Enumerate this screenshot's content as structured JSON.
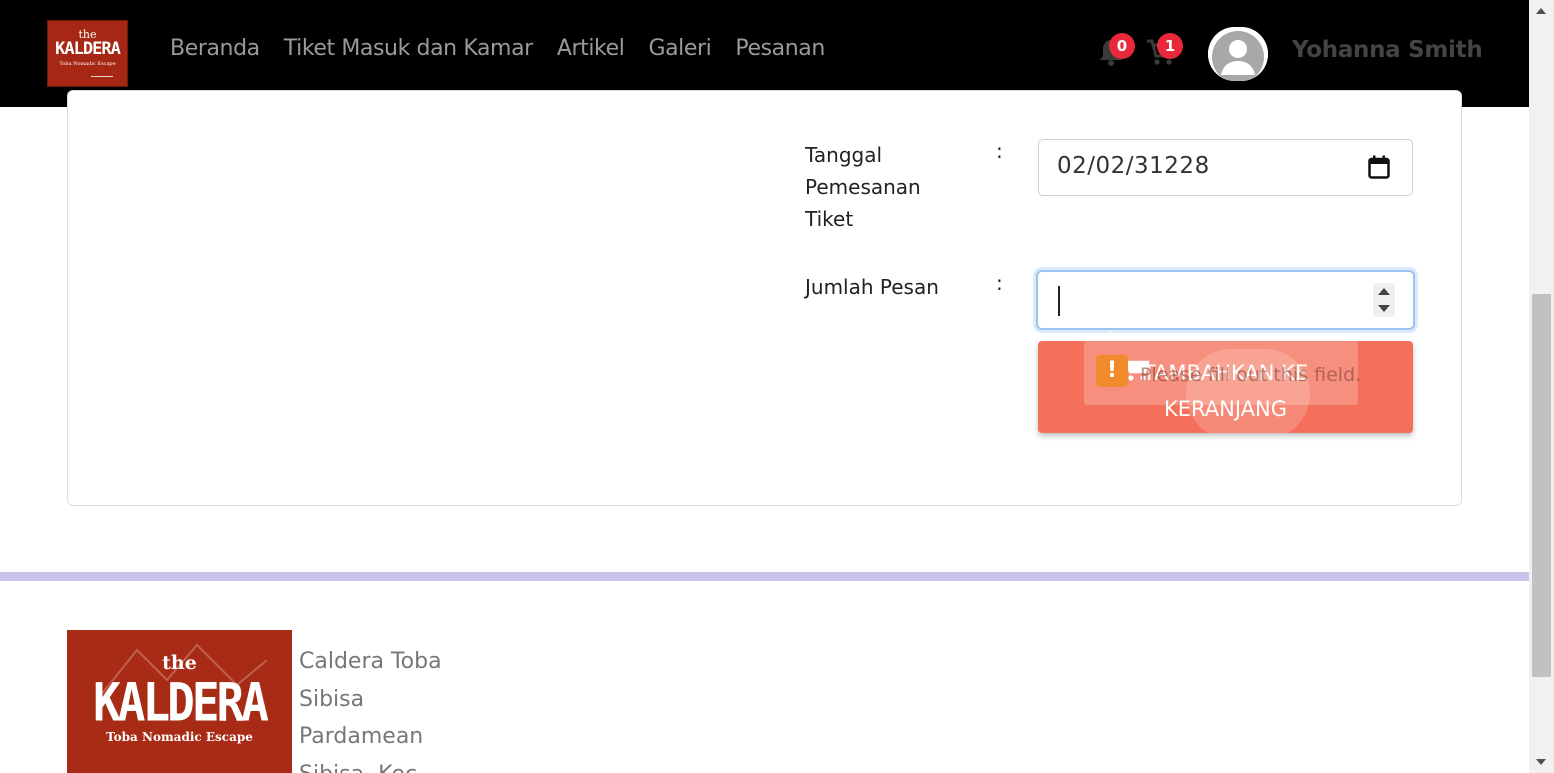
{
  "header": {
    "logo": {
      "the": "the",
      "name": "KALDERA",
      "tagline": "Toba Nomadic Escape"
    },
    "nav": [
      "Beranda",
      "Tiket Masuk dan Kamar",
      "Artikel",
      "Galeri",
      "Pesanan"
    ],
    "notifications": {
      "icon": "bell-icon",
      "count": "0"
    },
    "cart": {
      "icon": "cart-icon",
      "count": "1"
    },
    "user": {
      "avatar": "user-avatar",
      "name": "Yohanna Smith"
    }
  },
  "form": {
    "date_label": "Tanggal Pemesanan Tiket",
    "separator": ":",
    "date_value": "02/02/31228",
    "qty_label": "Jumlah Pesan",
    "qty_value": "",
    "submit_label": "TAMBAHKAN KE KERANJANG",
    "validation_message": "Please fill out this field.",
    "validation_icon": "!"
  },
  "footer": {
    "logo": {
      "the": "the",
      "name": "KALDERA",
      "tagline": "Toba Nomadic Escape"
    },
    "address_lines": [
      "Caldera Toba",
      "Sibisa",
      "Pardamean",
      "Sibisa, Kec."
    ]
  },
  "colors": {
    "navbar": "#000000",
    "brand": "#a52714",
    "badge": "#e8293c",
    "button": "#f5705a",
    "footer_bar": "#c8c4ea"
  }
}
